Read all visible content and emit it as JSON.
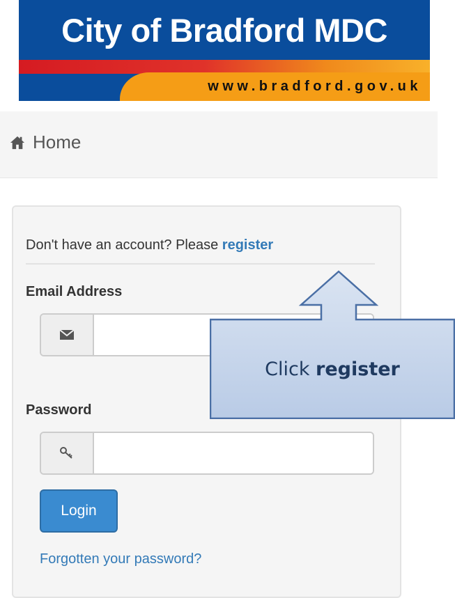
{
  "banner": {
    "title": "City of Bradford MDC",
    "url": "www.bradford.gov.uk"
  },
  "breadcrumb": {
    "home_label": "Home"
  },
  "login": {
    "register_prompt": "Don't have an account? Please ",
    "register_link": "register",
    "email_label": "Email Address",
    "email_value": "",
    "password_label": "Password",
    "password_value": "",
    "login_button": "Login",
    "forgot_link": "Forgotten your password?"
  },
  "callout": {
    "prefix": "Click ",
    "emphasis": "register"
  },
  "icons": {
    "home": "home-icon",
    "email": "envelope-icon",
    "password": "key-icon"
  },
  "colors": {
    "banner_blue": "#0a4d9c",
    "banner_red": "#d51b22",
    "banner_orange": "#f59d16",
    "link": "#337ab7",
    "button": "#3a8bd0",
    "callout_fill": "#c5d5ec",
    "callout_border": "#4a6fa5"
  }
}
